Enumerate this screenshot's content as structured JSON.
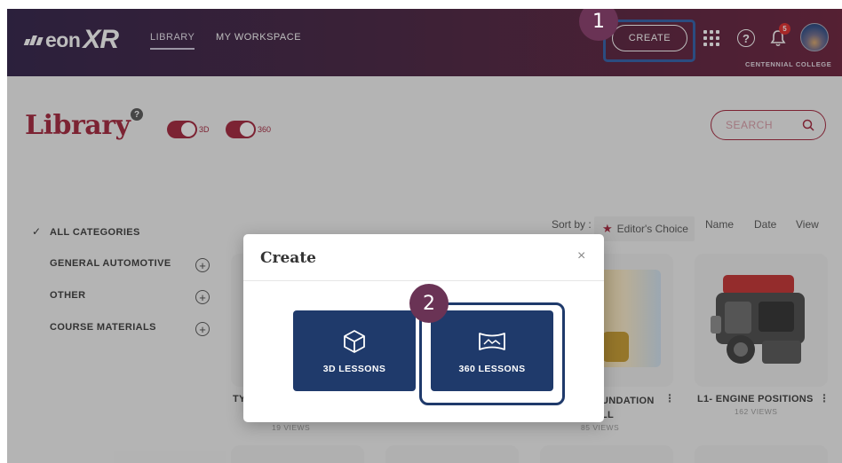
{
  "header": {
    "logo_text": "eon",
    "logo_xr": "XR",
    "nav": [
      {
        "label": "LIBRARY",
        "active": true
      },
      {
        "label": "MY WORKSPACE",
        "active": false
      }
    ],
    "create_label": "CREATE",
    "notification_count": "5",
    "help_symbol": "?",
    "org_name": "CENTENNIAL COLLEGE",
    "icons": [
      "apps-grid-icon",
      "help-icon",
      "bell-icon",
      "avatar"
    ]
  },
  "steps": [
    "1",
    "2"
  ],
  "library": {
    "title": "Library",
    "help_symbol": "?",
    "toggles": [
      {
        "label": "3D",
        "on": true
      },
      {
        "label": "360",
        "on": true
      }
    ],
    "search_placeholder": "SEARCH"
  },
  "categories": [
    {
      "label": "ALL CATEGORIES",
      "selected": true,
      "expandable": false
    },
    {
      "label": "GENERAL AUTOMOTIVE",
      "selected": false,
      "expandable": true
    },
    {
      "label": "OTHER",
      "selected": false,
      "expandable": true
    },
    {
      "label": "COURSE MATERIALS",
      "selected": false,
      "expandable": true
    }
  ],
  "sort": {
    "label": "Sort by :",
    "options": [
      "Editor's Choice",
      "Name",
      "Date",
      "View"
    ],
    "selected": "Editor's Choice"
  },
  "cards": [
    {
      "title": "TY",
      "views": "19 VIEWS"
    },
    {
      "title": "UNDATION\nLL",
      "views": "85 VIEWS"
    },
    {
      "title": "L1- ENGINE POSITIONS",
      "views": "162 VIEWS"
    }
  ],
  "modal": {
    "title": "Create",
    "close_symbol": "×",
    "buttons": [
      {
        "label": "3D LESSONS",
        "icon": "cube-icon"
      },
      {
        "label": "360 LESSONS",
        "icon": "panorama-360-icon"
      }
    ]
  },
  "colors": {
    "brand": "#a3233a",
    "nav_start": "#2f1f47",
    "nav_end": "#6a1f3a",
    "lesson_button": "#1f3a6b",
    "highlight": "#2f5ea8",
    "step_marker": "#6a3355"
  }
}
